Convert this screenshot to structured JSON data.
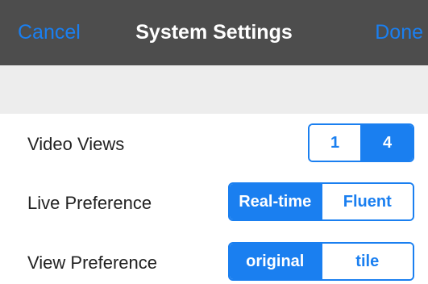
{
  "navbar": {
    "left_label": "Cancel",
    "title": "System Settings",
    "right_label": "Done"
  },
  "settings": [
    {
      "label": "Video Views",
      "options": [
        "1",
        "4"
      ],
      "selected": "4"
    },
    {
      "label": "Live Preference",
      "options": [
        "Real-time",
        "Fluent"
      ],
      "selected": "Real-time"
    },
    {
      "label": "View Preference",
      "options": [
        "original",
        "tile"
      ],
      "selected": "original"
    }
  ],
  "colors": {
    "accent": "#1a7ff0",
    "navbar_bg": "#4d4d4d",
    "spacer_bg": "#ededed"
  }
}
